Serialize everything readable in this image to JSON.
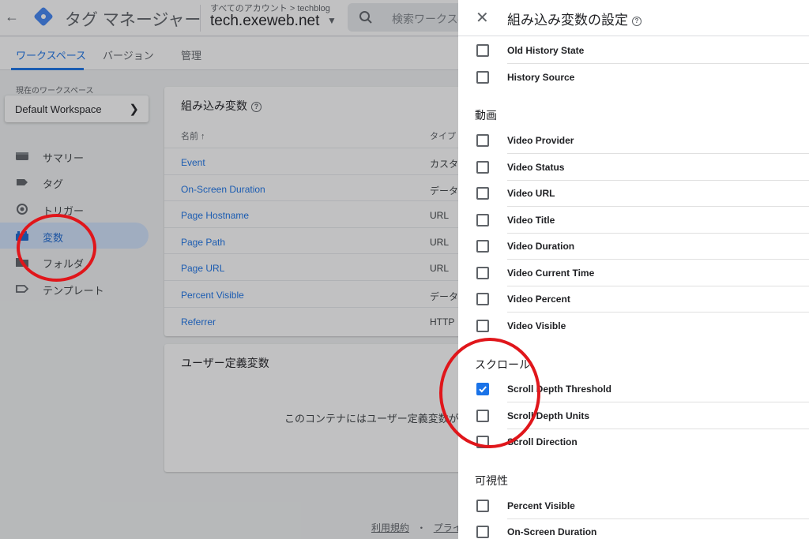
{
  "header": {
    "app_name": "タグ マネージャー",
    "account_crumb": "すべてのアカウント > techblog",
    "container_name": "tech.exeweb.net",
    "search_placeholder": "検索ワークスペース"
  },
  "tabs": [
    {
      "label": "ワークスペース",
      "active": true
    },
    {
      "label": "バージョン",
      "active": false
    },
    {
      "label": "管理",
      "active": false
    }
  ],
  "workspace": {
    "label": "現在のワークスペース",
    "name": "Default Workspace"
  },
  "sidebar": {
    "items": [
      {
        "label": "サマリー",
        "icon": "summary-icon"
      },
      {
        "label": "タグ",
        "icon": "tag-icon"
      },
      {
        "label": "トリガー",
        "icon": "trigger-icon"
      },
      {
        "label": "変数",
        "icon": "variable-icon",
        "active": true
      },
      {
        "label": "フォルダ",
        "icon": "folder-icon"
      },
      {
        "label": "テンプレート",
        "icon": "template-icon"
      }
    ]
  },
  "builtin_card": {
    "title": "組み込み変数",
    "col_name": "名前 ↑",
    "col_type": "タイプ",
    "rows": [
      {
        "name": "Event",
        "type": "カスタ"
      },
      {
        "name": "On-Screen Duration",
        "type": "データ"
      },
      {
        "name": "Page Hostname",
        "type": "URL"
      },
      {
        "name": "Page Path",
        "type": "URL"
      },
      {
        "name": "Page URL",
        "type": "URL"
      },
      {
        "name": "Percent Visible",
        "type": "データ"
      },
      {
        "name": "Referrer",
        "type": "HTTP"
      }
    ]
  },
  "user_card": {
    "title": "ユーザー定義変数",
    "empty_message": "このコンテナにはユーザー定義変数が"
  },
  "footer": {
    "terms": "利用規約",
    "separator": "・",
    "privacy": "プライバ"
  },
  "panel": {
    "title": "組み込み変数の設定",
    "history_items": [
      {
        "label": "Old History State",
        "checked": false
      },
      {
        "label": "History Source",
        "checked": false
      }
    ],
    "sections": [
      {
        "heading": "動画",
        "items": [
          {
            "label": "Video Provider",
            "checked": false
          },
          {
            "label": "Video Status",
            "checked": false
          },
          {
            "label": "Video URL",
            "checked": false
          },
          {
            "label": "Video Title",
            "checked": false
          },
          {
            "label": "Video Duration",
            "checked": false
          },
          {
            "label": "Video Current Time",
            "checked": false
          },
          {
            "label": "Video Percent",
            "checked": false
          },
          {
            "label": "Video Visible",
            "checked": false
          }
        ]
      },
      {
        "heading": "スクロール",
        "items": [
          {
            "label": "Scroll Depth Threshold",
            "checked": true
          },
          {
            "label": "Scroll Depth Units",
            "checked": false
          },
          {
            "label": "Scroll Direction",
            "checked": false
          }
        ]
      },
      {
        "heading": "可視性",
        "items": [
          {
            "label": "Percent Visible",
            "checked": false
          },
          {
            "label": "On-Screen Duration",
            "checked": false
          }
        ]
      }
    ]
  },
  "colors": {
    "accent": "#1a73e8",
    "annotation_red": "#e0161b"
  }
}
